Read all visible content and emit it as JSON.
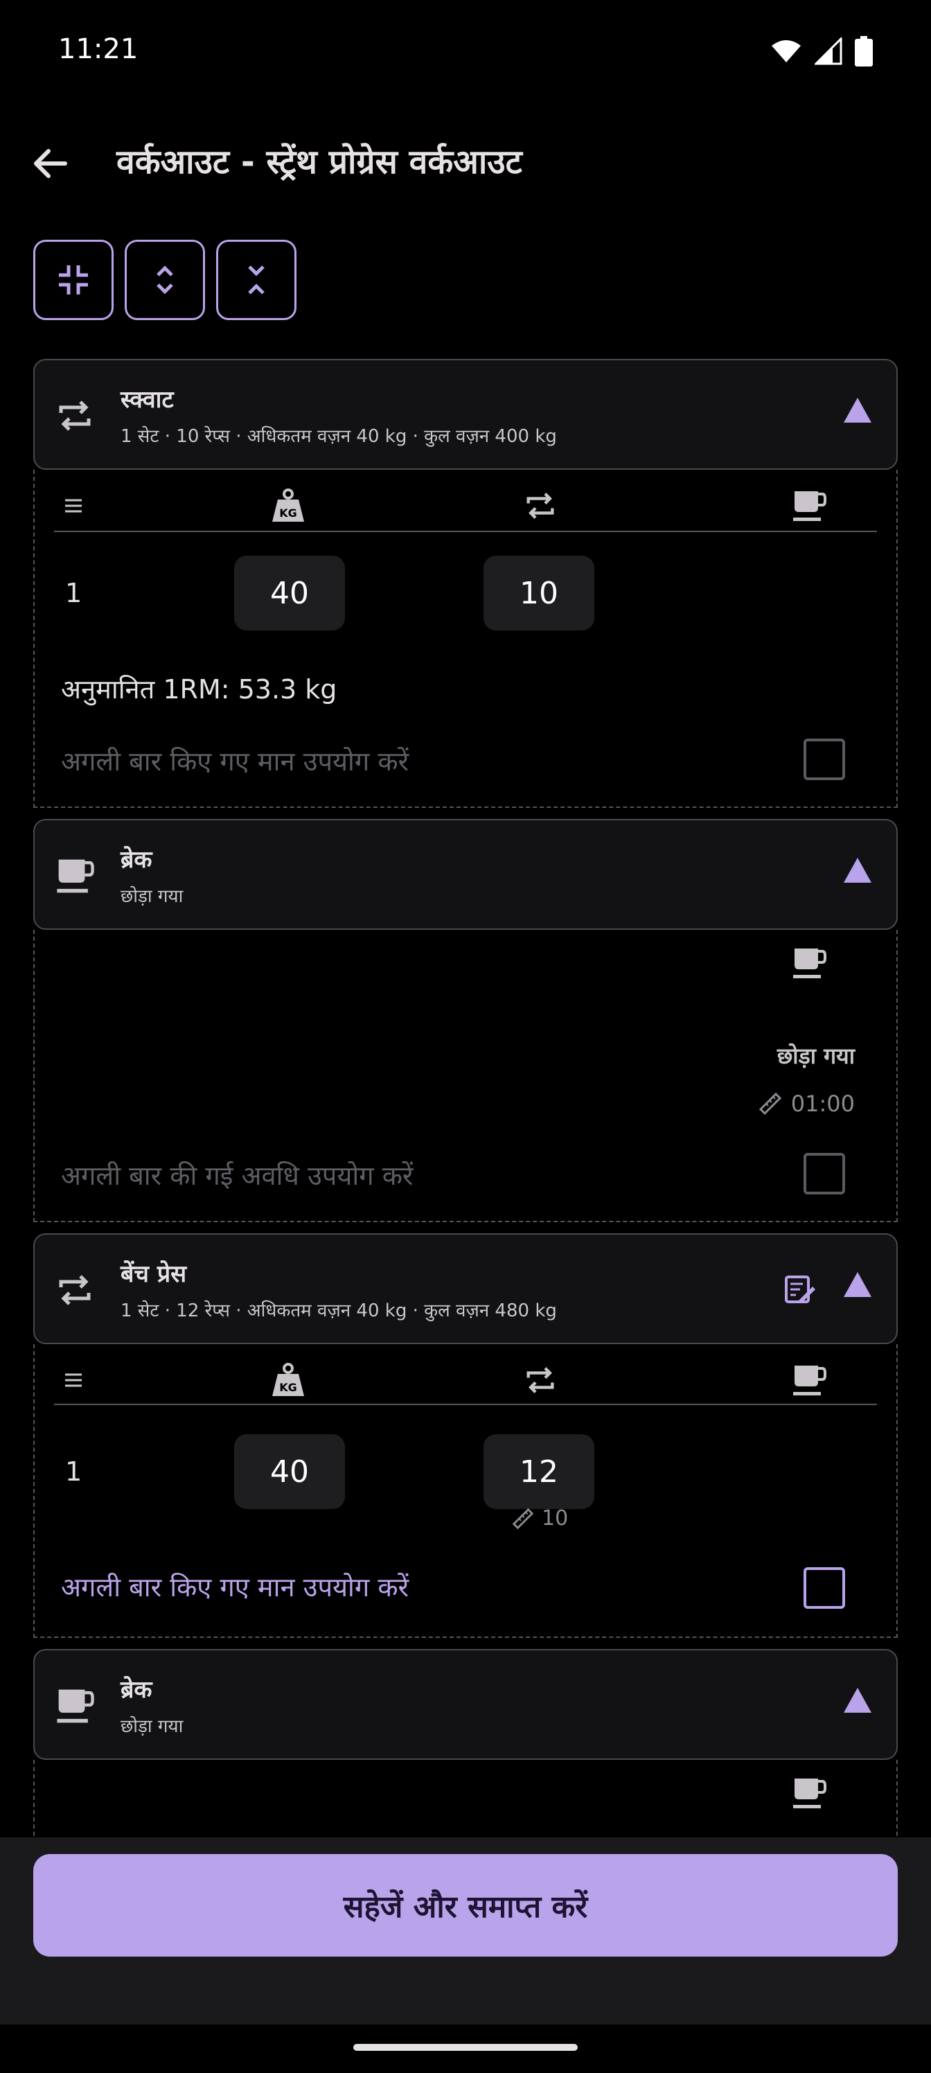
{
  "status": {
    "time": "11:21"
  },
  "header": {
    "title": "वर्कआउट - स्ट्रेंथ प्रोग्रेस वर्कआउट"
  },
  "exercises": [
    {
      "title": "स्क्वाट",
      "subtitle": "1 सेट · 10 रेप्स · अधिकतम वज़न 40 kg · कुल वज़न 400 kg",
      "set_number": "1",
      "weight": "40",
      "reps": "10",
      "one_rm": "अनुमानित 1RM: 53.3 kg",
      "use_last": "अगली बार किए गए मान उपयोग करें"
    },
    {
      "title": "ब्रेक",
      "subtitle": "छोड़ा गया",
      "status": "छोड़ा गया",
      "duration": "01:00",
      "use_last": "अगली बार की गई अवधि उपयोग करें"
    },
    {
      "title": "बेंच प्रेस",
      "subtitle": "1 सेट · 12 रेप्स · अधिकतम वज़न 40 kg · कुल वज़न 480 kg",
      "set_number": "1",
      "weight": "40",
      "reps": "12",
      "target_reps": "10",
      "use_last": "अगली बार किए गए मान उपयोग करें"
    },
    {
      "title": "ब्रेक",
      "subtitle": "छोड़ा गया"
    }
  ],
  "save_button": "सहेजें और समाप्त करें",
  "colors": {
    "accent": "#b9a3ea",
    "background": "#000000",
    "card": "#121214",
    "field": "#1e1e20"
  }
}
